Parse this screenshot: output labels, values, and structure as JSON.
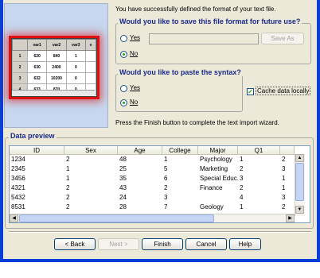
{
  "intro_text": "You have successfully defined the format of your text file.",
  "illustration": {
    "columns": [
      "var1",
      "var2",
      "var3",
      "v"
    ],
    "rows": [
      {
        "n": "1",
        "cells": [
          "620",
          "840",
          "1"
        ]
      },
      {
        "n": "2",
        "cells": [
          "630",
          "2400",
          "0"
        ]
      },
      {
        "n": "3",
        "cells": [
          "632",
          "10200",
          "0"
        ]
      },
      {
        "n": "4",
        "cells": [
          "633",
          "870",
          "0"
        ]
      }
    ]
  },
  "save_format": {
    "title": "Would you like to save this file format for future use?",
    "yes_label": "Yes",
    "no_label": "No",
    "selected": "No",
    "save_as_label": "Save As"
  },
  "paste_syntax": {
    "title": "Would you like to paste the syntax?",
    "yes_label": "Yes",
    "no_label": "No",
    "selected": "No"
  },
  "cache_data": {
    "label": "Cache data locally",
    "checked": true
  },
  "finish_hint": "Press the Finish button to complete the text import wizard.",
  "data_preview": {
    "title": "Data preview",
    "columns": [
      "ID",
      "Sex",
      "Age",
      "College",
      "Major",
      "Q1",
      ""
    ],
    "rows": [
      [
        "1234",
        "2",
        "48",
        "1",
        "Psychology",
        "1",
        "2"
      ],
      [
        "2345",
        "1",
        "25",
        "5",
        "Marketing",
        "2",
        "3"
      ],
      [
        "3456",
        "1",
        "35",
        "6",
        "Special Educ...",
        "3",
        "1"
      ],
      [
        "4321",
        "2",
        "43",
        "2",
        "Finance",
        "2",
        "1"
      ],
      [
        "5432",
        "2",
        "24",
        "3",
        "",
        "4",
        "3"
      ],
      [
        "8531",
        "2",
        "28",
        "7",
        "Geology",
        "1",
        "2"
      ]
    ]
  },
  "buttons": {
    "back": "< Back",
    "next": "Next >",
    "finish": "Finish",
    "cancel": "Cancel",
    "help": "Help"
  }
}
